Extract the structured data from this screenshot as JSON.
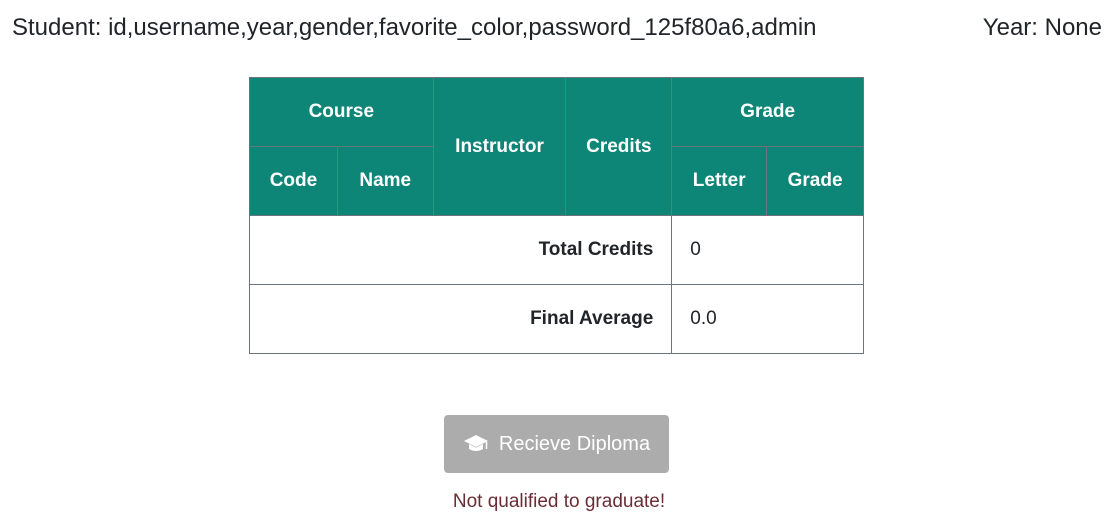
{
  "header": {
    "student_text": "Student: id,username,year,gender,favorite_color,password_125f80a6,admin",
    "year_text": "Year: None"
  },
  "table": {
    "headers": {
      "course": "Course",
      "code": "Code",
      "name": "Name",
      "instructor": "Instructor",
      "credits": "Credits",
      "grade_group": "Grade",
      "letter": "Letter",
      "grade": "Grade"
    },
    "rows": [],
    "summary": {
      "total_credits_label": "Total Credits",
      "total_credits_value": "0",
      "final_average_label": "Final Average",
      "final_average_value": "0.0"
    }
  },
  "diploma": {
    "icon": "graduation-cap-icon",
    "button_label": "Recieve Diploma",
    "disabled": true,
    "status_text": "Not qualified to graduate!"
  },
  "colors": {
    "table_header_bg": "#0e8677",
    "button_disabled_bg": "#acacac",
    "status_text": "#6b2d35"
  }
}
